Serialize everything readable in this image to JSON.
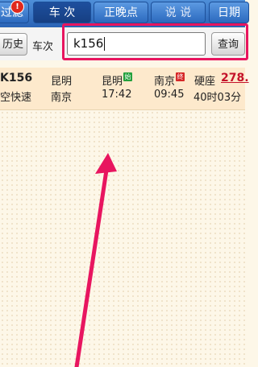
{
  "topbar": {
    "filter_label": "过滤",
    "filter_badge": "!",
    "tabs": [
      {
        "label": "车  次"
      },
      {
        "label": "正晚点"
      },
      {
        "label": "说  说"
      }
    ],
    "date_label": "日期"
  },
  "search": {
    "history_label": "历史",
    "field_label": "车次",
    "value": "k156",
    "query_label": "查询"
  },
  "result": {
    "train_no": "K156",
    "train_type": "空快速",
    "from_station": "昆明",
    "to_station": "南京",
    "board_station": "昆明",
    "start_tag": "始",
    "depart_time": "17:42",
    "arrive_station": "南京",
    "end_tag": "终",
    "arrive_time": "09:45",
    "seat_type": "硬座",
    "price": "278.",
    "duration": "40时03分"
  },
  "colors": {
    "accent": "#e8155f",
    "topbar": "#2a63b5",
    "result_bg": "#fde9cc"
  }
}
